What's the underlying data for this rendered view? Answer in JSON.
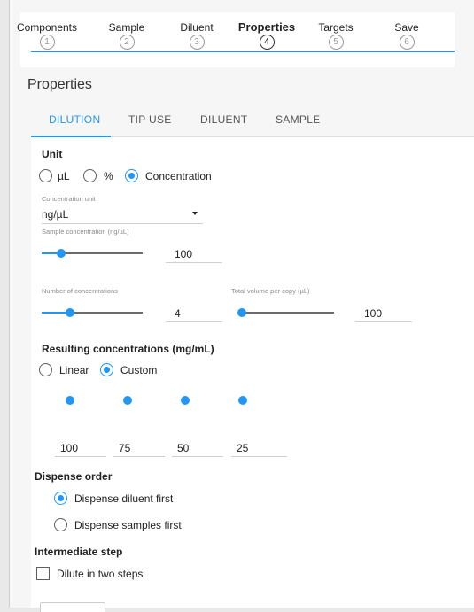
{
  "stepper": {
    "steps": [
      {
        "label": "Components",
        "num": "1"
      },
      {
        "label": "Sample",
        "num": "2"
      },
      {
        "label": "Diluent",
        "num": "3"
      },
      {
        "label": "Properties",
        "num": "4"
      },
      {
        "label": "Targets",
        "num": "5"
      },
      {
        "label": "Save",
        "num": "6"
      }
    ],
    "active_index": 3
  },
  "section_title": "Properties",
  "tabs": [
    "DILUTION",
    "TIP USE",
    "DILUENT",
    "SAMPLE"
  ],
  "unit": {
    "heading": "Unit",
    "options": [
      "µL",
      "%",
      "Concentration"
    ],
    "selected": "Concentration"
  },
  "concentration_unit": {
    "label": "Concentration unit",
    "value": "ng/µL"
  },
  "sample_concentration": {
    "label": "Sample concentration (ng/µL)",
    "value": "100",
    "slider_fraction": 0.1
  },
  "number_of_concentrations": {
    "label": "Number of concentrations",
    "value": "4",
    "slider_fraction": 0.2
  },
  "total_volume": {
    "label": "Total volume per copy (µL)",
    "value": "100",
    "slider_fraction": 0.0
  },
  "resulting": {
    "heading": "Resulting concentrations (mg/mL)",
    "options": [
      "Linear",
      "Custom"
    ],
    "selected": "Custom",
    "values": [
      "100",
      "75",
      "50",
      "25"
    ]
  },
  "dispense_order": {
    "heading": "Dispense order",
    "options": [
      "Dispense diluent first",
      "Dispense samples first"
    ],
    "selected": "Dispense diluent first"
  },
  "intermediate": {
    "heading": "Intermediate step",
    "checkbox_label": "Dilute in two steps",
    "checked": false
  },
  "colors": {
    "accent": "#2196f3"
  }
}
